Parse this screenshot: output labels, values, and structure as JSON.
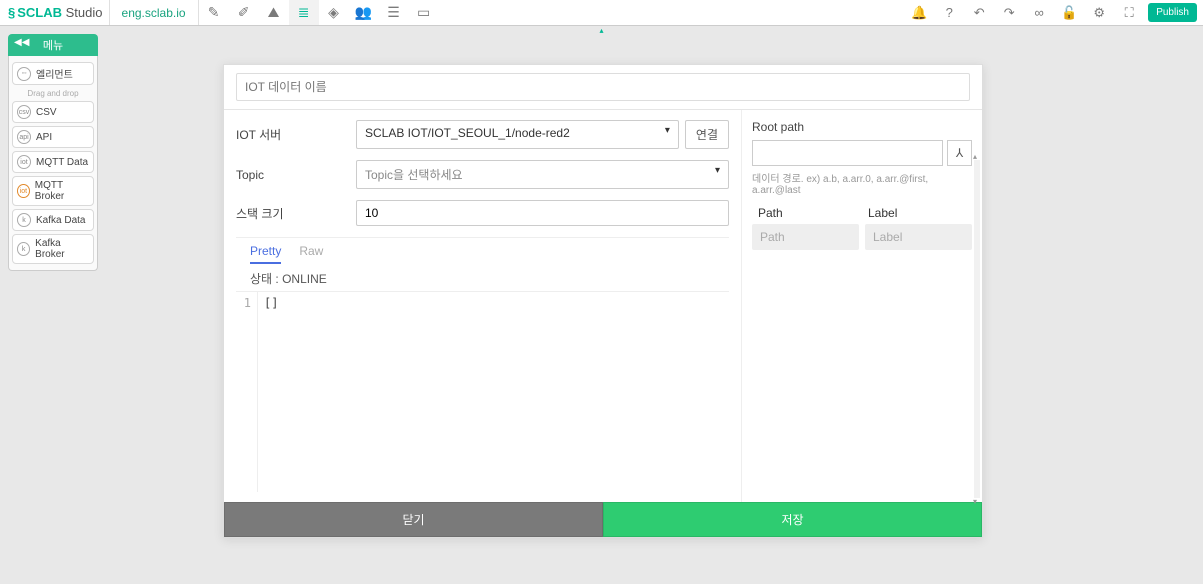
{
  "brand": {
    "name": "SCLAB",
    "suffix": "Studio"
  },
  "domain": "eng.sclab.io",
  "publish_label": "Publish",
  "left_panel": {
    "title": "메뉴",
    "drag_hint": "Drag and drop",
    "items": [
      {
        "label": "엘리먼트"
      },
      {
        "label": "CSV"
      },
      {
        "label": "API"
      },
      {
        "label": "MQTT Data"
      },
      {
        "label": "MQTT Broker"
      },
      {
        "label": "Kafka Data"
      },
      {
        "label": "Kafka Broker"
      }
    ]
  },
  "modal": {
    "name_placeholder": "IOT 데이터 이름",
    "server_label": "IOT 서버",
    "server_value": "SCLAB IOT/IOT_SEOUL_1/node-red2",
    "connect_label": "연결",
    "topic_label": "Topic",
    "topic_value": "Topic을 선택하세요",
    "stack_label": "스택 크기",
    "stack_value": "10",
    "rootpath_label": "Root path",
    "hint": "데이터 경로. ex) a.b, a.arr.0, a.arr.@first, a.arr.@last",
    "path_header": "Path",
    "label_header": "Label",
    "path_placeholder": "Path",
    "label_placeholder": "Label",
    "tabs": {
      "pretty": "Pretty",
      "raw": "Raw"
    },
    "status_prefix": "상태 : ",
    "status_value": "ONLINE",
    "code_line_no": "1",
    "code_content": "[]",
    "close_label": "닫기",
    "save_label": "저장"
  }
}
